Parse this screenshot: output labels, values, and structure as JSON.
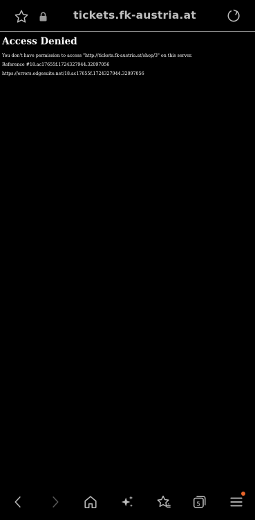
{
  "browser": {
    "url": "tickets.fk-austria.at",
    "icons": [
      "star-outline-icon",
      "lock-icon",
      "reload-icon"
    ]
  },
  "page": {
    "title": "Access Denied",
    "message": "You don't have permission to access \"http://tickets.fk-austria.at/shop/3\" on this server.",
    "reference": "Reference #18.ac17655f.1724327944.32097056",
    "error_url": "https://errors.edgesuite.net/18.ac17655f.1724327944.32097056"
  },
  "bottom_nav": {
    "tab_count": "5",
    "icons": [
      "back-icon",
      "forward-icon",
      "home-icon",
      "ai-sparkle-icon",
      "bookmarks-icon",
      "tabs-icon",
      "menu-icon"
    ],
    "menu_badge_color": "#e8642a"
  }
}
